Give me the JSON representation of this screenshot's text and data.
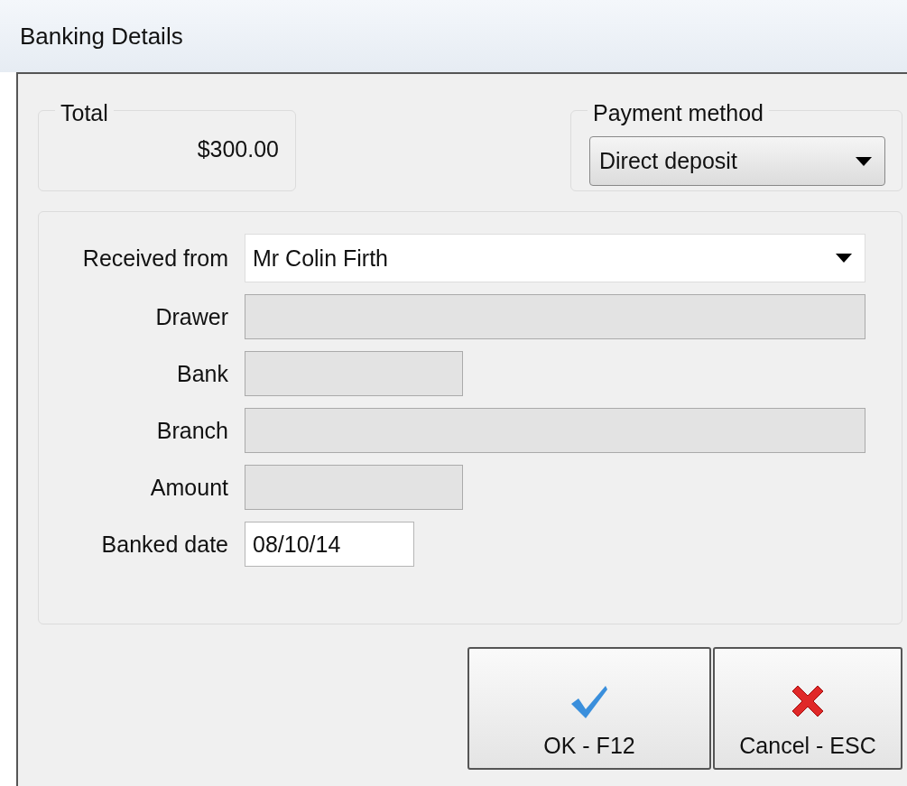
{
  "window": {
    "title": "Banking Details"
  },
  "total": {
    "legend": "Total",
    "value": "$300.00"
  },
  "payment_method": {
    "legend": "Payment method",
    "value": "Direct deposit"
  },
  "fields": [
    {
      "label": "Received from",
      "kind": "combo",
      "value": "Mr Colin Firth",
      "disabled": false
    },
    {
      "label": "Drawer",
      "kind": "long",
      "disabled": true
    },
    {
      "label": "Bank",
      "kind": "short",
      "disabled": true
    },
    {
      "label": "Branch",
      "kind": "long",
      "disabled": true
    },
    {
      "label": "Amount",
      "kind": "short",
      "disabled": true
    },
    {
      "label": "Banked date",
      "kind": "date",
      "value": "08/10/14",
      "disabled": false
    }
  ],
  "buttons": [
    {
      "label": "OK - F12",
      "kind": "ok"
    },
    {
      "label": "Cancel - ESC",
      "kind": "cancel"
    }
  ]
}
